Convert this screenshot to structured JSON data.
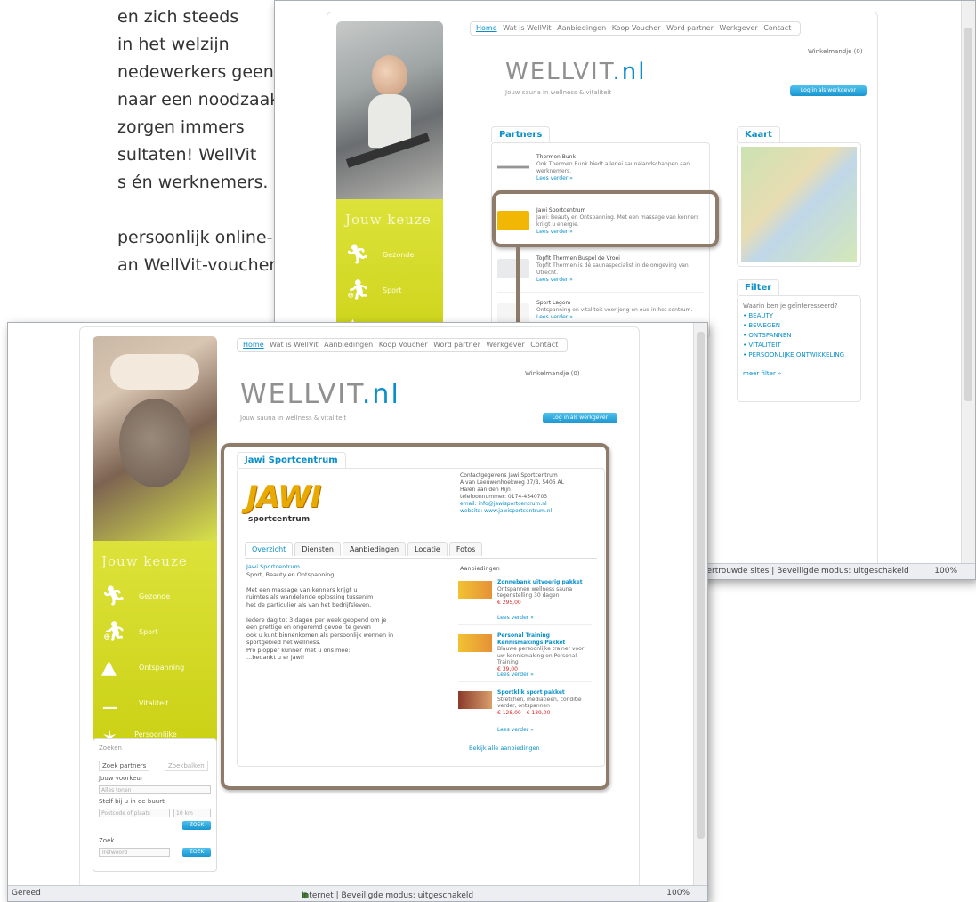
{
  "intro_text": [
    "en zich steeds",
    "in het welzijn",
    "nedewerkers geen",
    "naar een noodzaak.",
    "zorgen immers",
    "sultaten! WellVit",
    "s én werknemers.",
    "",
    "persoonlijk online-",
    "an WellVit-vouchers"
  ],
  "site": {
    "nav": [
      "Home",
      "Wat is WellVit",
      "Aanbiedingen",
      "Koop Voucher",
      "Word partner",
      "Werkgever",
      "Contact"
    ],
    "logo_main": "WELLVIT",
    "logo_tld": ".nl",
    "tagline": "Jouw sauna in wellness & vitaliteit",
    "cart": "Winkelmandje (0)",
    "cta": "Log in als werkgever",
    "side_heading": "Jouw keuze",
    "side_items": [
      "Gezonde",
      "Sport",
      "Ontspanning",
      "Vitaliteit",
      "Persoonlijke ontwikkeling"
    ]
  },
  "back_window": {
    "partners_tab": "Partners",
    "partners": [
      {
        "name": "Thermen Bunk",
        "text": "Ook Thermen Bunk biedt allerlei saunalandschappen aan werknemers.",
        "more": "Lees verder »"
      },
      {
        "name": "Jawi Sportcentrum",
        "text": "Jawi: Beauty en Ontspanning. Met een massage van kenners krijgt u energie.",
        "more": "Lees verder »"
      },
      {
        "name": "Topfit Thermen Buspel de Vroei",
        "text": "Topfit Thermen is dé saunaspecialist in de omgeving van Utrecht.",
        "more": "Lees verder »"
      },
      {
        "name": "Sport Lagom",
        "text": "Ontspanning en vitaliteit voor jong en oud in het centrum.",
        "more": "Lees verder »"
      }
    ],
    "map_tab": "Kaart",
    "filter_tab": "Filter",
    "filter_intro": "Waarin ben je geïnteresseerd?",
    "filters": [
      "• BEAUTY",
      "• BEWEGEN",
      "• ONTSPANNEN",
      "• VITALITEIT",
      "• PERSOONLIJKE ONTWIKKELING"
    ],
    "more_filters": "meer filter »",
    "status": "Vertrouwde sites | Beveiligde modus: uitgeschakeld",
    "zoom": "100%"
  },
  "front_window": {
    "detail_tab": "Jawi Sportcentrum",
    "brand": "JAWI",
    "brand_sub": "sportcentrum",
    "address": [
      "Contactgegevens Jawi Sportcentrum",
      "A van Leeuwenhoekweg 37/B, 5406 AL",
      "Halen aan den Rijn",
      "telefoonnummer: 0174-4540703"
    ],
    "email": "email: info@jawisportcentrum.nl",
    "website": "website: www.jawisportcentrum.nl",
    "tabs": [
      "Overzicht",
      "Diensten",
      "Aanbiedingen",
      "Locatie",
      "Fotos"
    ],
    "desc_heading": "Jawi Sportcentrum",
    "desc_lines": [
      "Sport, Beauty en Ontspanning.",
      "",
      "Met een massage van kenners krijgt u",
      "ruimtes als wandelende oplossing tussenim",
      "het de particulier als van het bedrijfsleven.",
      "",
      "Iedere dag tot 3 dagen per week geopend om je",
      "een prettige en ongeremd gevoel te geven",
      "ook u kunt binnenkomen als persoonlijk wennen in",
      "sportgebied het wellness.",
      "Pro plopper kunnen met u ons mee:",
      "...bedankt u er jawi!"
    ],
    "offers_heading": "Aanbiedingen",
    "offers": [
      {
        "title": "Zonnebank uitvoerig pakket",
        "text": "Ontspannen wellness sauna tegenstelling 30 dagen",
        "price": "€ 295,00",
        "more": "Lees verder »"
      },
      {
        "title": "Personal Training Kennismakings Pakket",
        "text": "Blauwe persoonlijke trainer voor uw kennismaking en Personal Training",
        "price": "€ 39,00",
        "more": "Lees verder »"
      },
      {
        "title": "Sportklik sport pakket",
        "text": "Stretchen, mediatieen, conditie verder, ontspannen",
        "price": "€ 128,00 - € 139,00",
        "more": "Lees verder »"
      }
    ],
    "all_offers": "Bekijk alle aanbiedingen",
    "zoek": {
      "heading": "Zoeken",
      "tab1": "Zoek partners",
      "tab2": "Zoekbalken",
      "label1": "Jouw voorkeur",
      "select1": "Alles tonen",
      "label2": "Stelf bij u in de buurt",
      "input2": "Postcode of plaats",
      "select2": "10 km",
      "btn1": "ZOEK",
      "label3": "Zoek",
      "input3": "Trefwoord",
      "btn2": "ZOEK"
    },
    "status_left": "Gereed",
    "status_mid": "Internet | Beveiligde modus: uitgeschakeld",
    "zoom": "100%"
  },
  "colors": {
    "accent": "#0a8fc9",
    "lime": "#c8cf0f",
    "frame": "#8f7b6a"
  }
}
